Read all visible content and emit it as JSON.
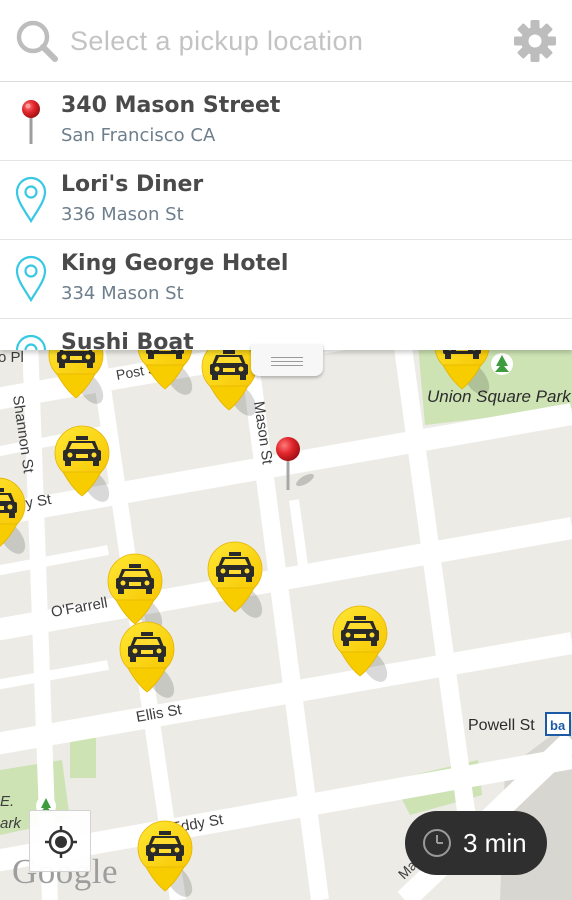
{
  "search": {
    "placeholder": "Select a pickup location"
  },
  "suggestions": [
    {
      "title": "340 Mason Street",
      "subtitle": "San Francisco CA",
      "pin": "red-pushpin"
    },
    {
      "title": "Lori's Diner",
      "subtitle": "336 Mason St",
      "pin": "outline-location-pin"
    },
    {
      "title": "King George Hotel",
      "subtitle": "334 Mason St",
      "pin": "outline-location-pin"
    },
    {
      "title": "Sushi Boat",
      "subtitle": "",
      "pin": "outline-location-pin"
    }
  ],
  "map": {
    "streets": {
      "post": "Post St",
      "geary": "eary St",
      "ofarrell": "O'Farrell",
      "ellis": "Ellis St",
      "eddy": "Eddy St",
      "shannon": "Shannon St",
      "mason": "Mason St",
      "market": "Market St",
      "cut_left": "o Pl",
      "ne_cut_1": "E.",
      "ne_cut_2": "ark"
    },
    "places": {
      "union_square": "Union Square Park",
      "powell_station": "Powell St",
      "bart_badge": "ba"
    },
    "taxi_count": 13
  },
  "eta": {
    "label": "3 min"
  },
  "google_logo": "Google",
  "colors": {
    "accent_teal": "#37c8e3",
    "taxi_yellow": "#ffd200",
    "pin_red": "#d8232a",
    "eta_background": "#2f2f2f",
    "map_background": "#ecebe6",
    "park_green": "#cde3b4"
  }
}
